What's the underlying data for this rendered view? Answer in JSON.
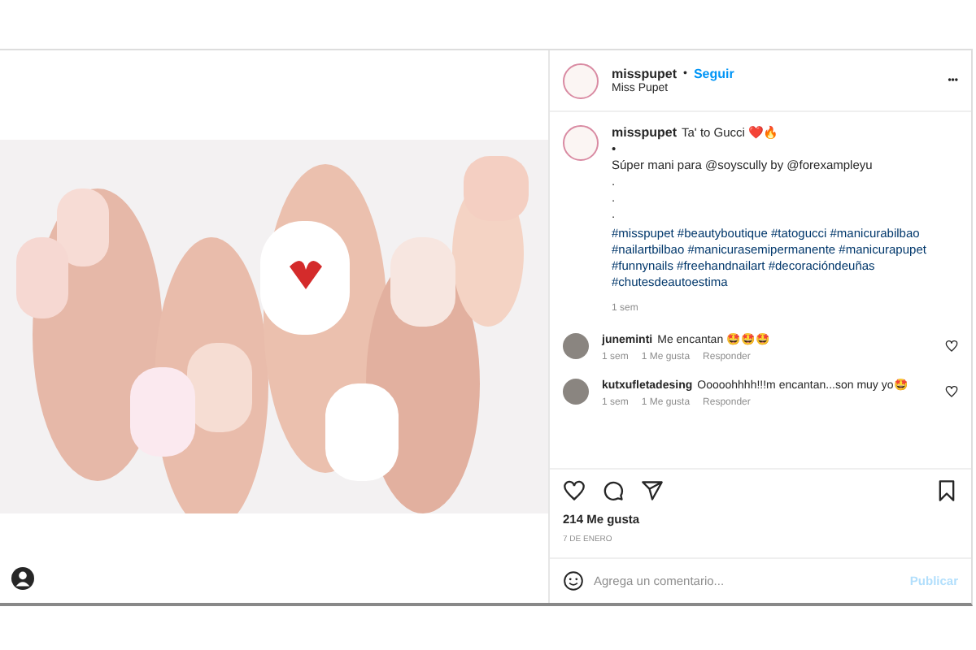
{
  "post": {
    "username": "misspupet",
    "follow": "Seguir",
    "separator": "•",
    "subtitle": "Miss Pupet",
    "more": "•••"
  },
  "caption": {
    "username": "misspupet",
    "lines": [
      "Ta' to Gucci ❤️🔥",
      "•",
      "Súper mani para @soyscully by @forexampleyu",
      ".",
      ".",
      ".",
      "#misspupet #beautyboutique #tatogucci #manicurabilbao #nailartbilbao #manicurasemipermanente #manicurapupet #funnynails #freehandnailart #decoracióndeuñas #chutesdeautoestima"
    ],
    "time": "1 sem"
  },
  "comments": [
    {
      "username": "juneminti",
      "text": "Me encantan 🤩🤩🤩",
      "time": "1 sem",
      "likes": "1 Me gusta",
      "reply": "Responder",
      "liked": false
    },
    {
      "username": "kutxufletadesing",
      "text": "Ooooohhhh!!!m encantan...son muy yo🤩",
      "time": "1 sem",
      "likes": "1 Me gusta",
      "reply": "Responder",
      "liked": false
    }
  ],
  "likes": "214 Me gusta",
  "date": "7 DE ENERO",
  "comment_box": {
    "placeholder": "Agrega un comentario...",
    "submit": "Publicar"
  }
}
